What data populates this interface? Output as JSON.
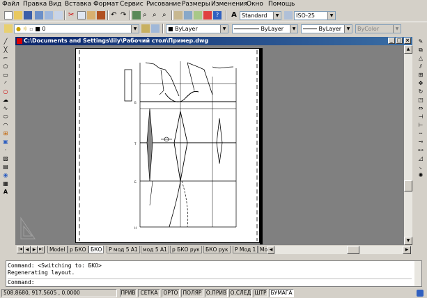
{
  "menu": {
    "items": [
      "Файл",
      "Правка",
      "Вид",
      "Вставка",
      "Формат",
      "Сервис",
      "Рисование",
      "Размеры",
      "Изменения",
      "Окно",
      "Помощь"
    ]
  },
  "toolbar": {
    "text_style": "Standard",
    "dim_style": "ISO-25",
    "layer": "0",
    "color": "ByLayer",
    "linetype": "ByLayer",
    "lineweight": "ByLayer",
    "plotstyle": "ByColor"
  },
  "window": {
    "title": "C:\\Documents and Settings\\lily\\Рабочий стол\\Пример.dwg"
  },
  "tabs": [
    "Model",
    "р БКО",
    "БКО",
    "Р мод 5 А1",
    "мод 5 А1",
    "р БКО рук",
    "БКО рук",
    "Р Мод 1",
    "Мо"
  ],
  "active_tab": "БКО",
  "command": {
    "line1": "Command:  <Switching to: БКО>",
    "line2": "Regenerating layout.",
    "prompt": "Command:"
  },
  "status": {
    "coords": "508.8680, 917.5605 , 0.0000",
    "toggles": [
      "ПРИВ",
      "СЕТКА",
      "ОРТО",
      "ПОЛЯР",
      "О.ПРИВ",
      "О.СЛЕД",
      "ШТР",
      "БУМАГА"
    ]
  }
}
